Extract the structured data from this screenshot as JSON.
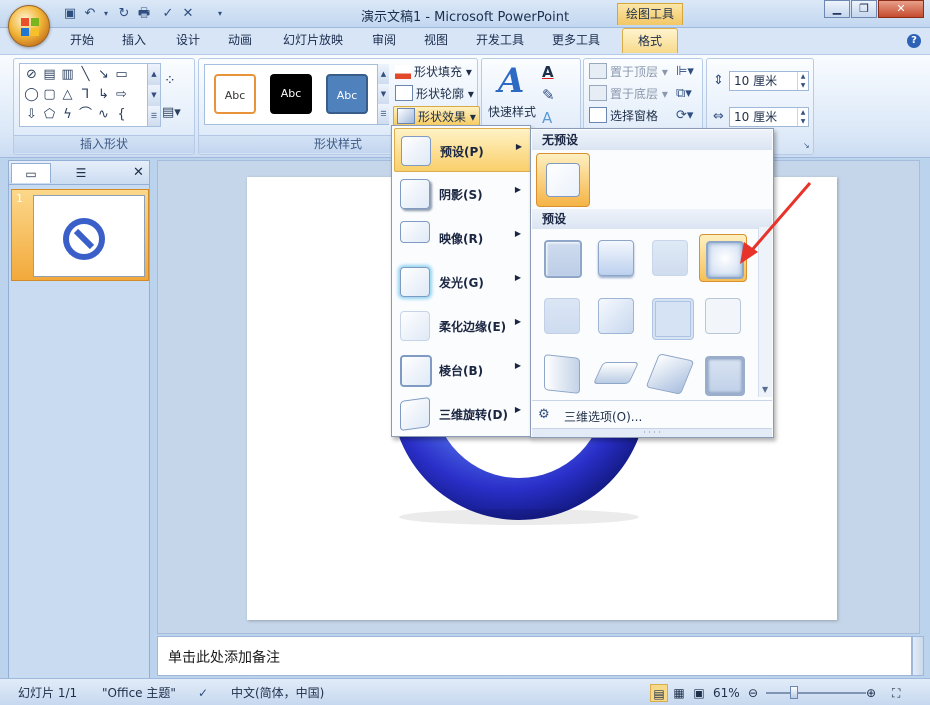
{
  "window": {
    "title": "演示文稿1 - Microsoft PowerPoint",
    "context_tab_label": "绘图工具"
  },
  "tabs": [
    "开始",
    "插入",
    "设计",
    "动画",
    "幻灯片放映",
    "审阅",
    "视图",
    "开发工具",
    "更多工具",
    "格式"
  ],
  "ribbon": {
    "insert_shapes": {
      "label": "插入形状"
    },
    "shape_styles": {
      "label": "形状样式",
      "thumbs": [
        "Abc",
        "Abc",
        "Abc"
      ],
      "fill": "形状填充",
      "outline": "形状轮廓",
      "effects": "形状效果"
    },
    "wordart": {
      "quick_styles": "快速样式"
    },
    "arrange": {
      "bring_front": "置于顶层",
      "send_back": "置于底层",
      "selection_pane": "选择窗格"
    },
    "size": {
      "height": "10 厘米",
      "width": "10 厘米"
    }
  },
  "effects_menu": {
    "items": [
      {
        "label": "预设(P)"
      },
      {
        "label": "阴影(S)"
      },
      {
        "label": "映像(R)"
      },
      {
        "label": "发光(G)"
      },
      {
        "label": "柔化边缘(E)"
      },
      {
        "label": "棱台(B)"
      },
      {
        "label": "三维旋转(D)"
      }
    ]
  },
  "preset_gallery": {
    "no_preset_header": "无预设",
    "preset_header": "预设",
    "footer": "三维选项(O)..."
  },
  "left_panel": {
    "slide_number": "1"
  },
  "notes": {
    "placeholder": "单击此处添加备注"
  },
  "status": {
    "slide": "幻灯片 1/1",
    "theme": "\"Office 主题\"",
    "language": "中文(简体，中国)",
    "zoom": "61%"
  },
  "colors": {
    "accent_orange": "#f2a93b",
    "ribbon_blue": "#dbe8f8",
    "arrow_red": "#e8332b"
  }
}
